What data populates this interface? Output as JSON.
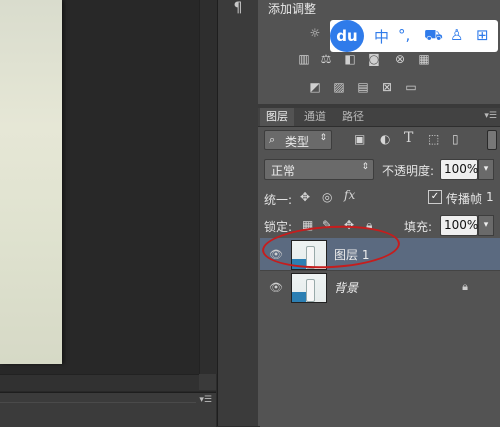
{
  "document": {
    "panel_menu_icon": "panel-menu-icon"
  },
  "strip": {
    "paragraph_icon": "¶"
  },
  "adjustments": {
    "title": "添加调整",
    "row1": [
      "brightness-icon"
    ],
    "row2": [
      "levels-icon",
      "balance-icon",
      "bw-icon",
      "photo-filter-icon",
      "channel-mixer-icon"
    ],
    "row3": [
      "invert-icon",
      "posterize-icon",
      "threshold-icon",
      "selective-color-icon",
      "gradient-map-icon"
    ]
  },
  "ime": {
    "logo": "du",
    "items": [
      "中",
      "°,",
      "toolbox-icon",
      "user-icon",
      "grid-icon"
    ]
  },
  "tabs": {
    "items": [
      {
        "label": "图层",
        "active": true
      },
      {
        "label": "通道",
        "active": false
      },
      {
        "label": "路径",
        "active": false
      }
    ]
  },
  "filter": {
    "prefix_icon": "⌕",
    "label": "类型"
  },
  "blend": {
    "mode": "正常",
    "opacity_label": "不透明度:",
    "opacity": "100%"
  },
  "unify": {
    "label": "统一:",
    "propagate_label": "传播帧",
    "propagate_value": "1",
    "propagate_checked": true
  },
  "lock": {
    "label": "锁定:",
    "fill_label": "填充:",
    "fill": "100%"
  },
  "layers": [
    {
      "name": "图层 1",
      "selected": true,
      "locked": false,
      "italic": false
    },
    {
      "name": "背景",
      "selected": false,
      "locked": true,
      "italic": true
    }
  ],
  "colors": {
    "accent": "#2f7bea",
    "selected_row": "#5b6a80",
    "annotation": "#c51d1d"
  }
}
